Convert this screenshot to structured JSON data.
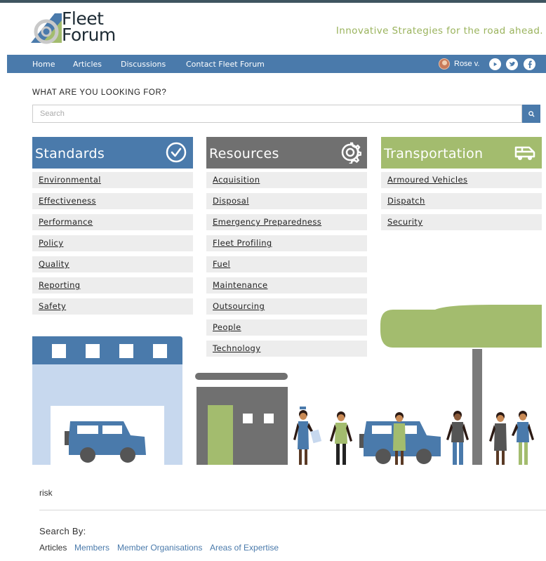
{
  "header": {
    "logo_line1": "Fleet",
    "logo_line2": "Forum",
    "tagline": "Innovative Strategies for the road ahead."
  },
  "nav": {
    "items": [
      "Home",
      "Articles",
      "Discussions",
      "Contact Fleet Forum"
    ],
    "user_name": "Rose v.",
    "social_icons": [
      "youtube-icon",
      "twitter-icon",
      "facebook-icon"
    ]
  },
  "search": {
    "heading": "WHAT ARE YOU LOOKING FOR?",
    "placeholder": "Search",
    "button_icon": "search-icon"
  },
  "columns": [
    {
      "title": "Standards",
      "icon": "checkmark-circle-icon",
      "color": "#4a7aab",
      "links": [
        "Environmental",
        "Effectiveness",
        "Performance",
        "Policy",
        "Quality",
        "Reporting",
        "Safety"
      ]
    },
    {
      "title": "Resources",
      "icon": "gear-icon",
      "color": "#707070",
      "links": [
        "Acquisition",
        "Disposal",
        "Emergency Preparedness",
        "Fleet Profiling",
        "Fuel",
        "Maintenance",
        "Outsourcing",
        "People",
        "Technology"
      ]
    },
    {
      "title": "Transportation",
      "icon": "van-icon",
      "color": "#a3bc6e",
      "links": [
        "Armoured Vehicles",
        "Dispatch",
        "Security"
      ]
    }
  ],
  "bottom": {
    "query": "risk",
    "search_by_label": "Search By:",
    "filters": [
      {
        "label": "Articles",
        "color": "#333333"
      },
      {
        "label": "Members",
        "color": "#4a7aab"
      },
      {
        "label": "Member Organisations",
        "color": "#4a7aab"
      },
      {
        "label": "Areas of Expertise",
        "color": "#4a7aab"
      }
    ]
  },
  "colors": {
    "nav": "#4a7aab",
    "tagline": "#9ab35c",
    "green": "#a3bc6e",
    "gray": "#707070"
  }
}
